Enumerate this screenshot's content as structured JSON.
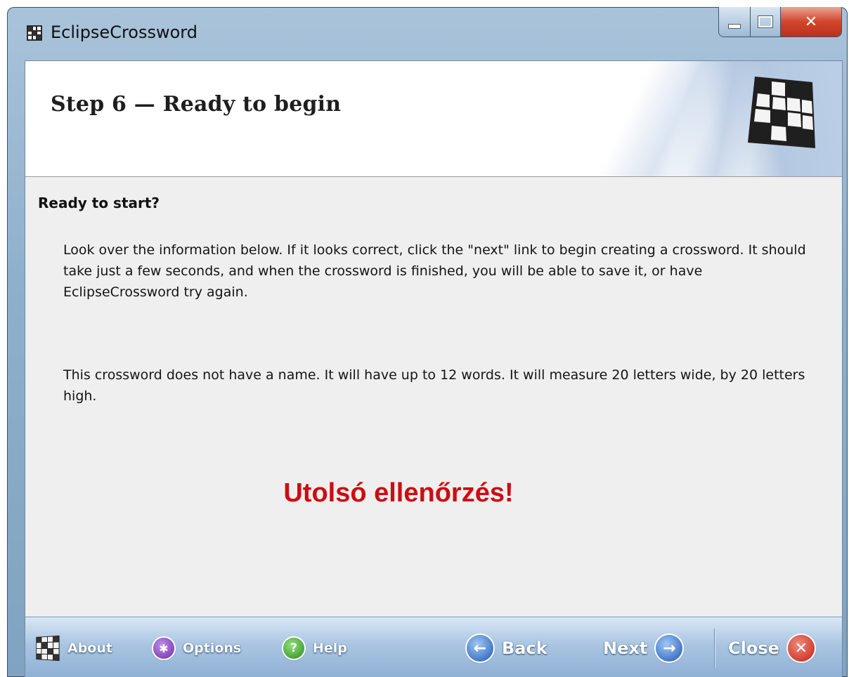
{
  "window": {
    "title": "EclipseCrossword",
    "icons": {
      "app": "crossword-grid-icon",
      "minimize": "minimize-icon",
      "maximize": "maximize-icon",
      "close": "close-x-icon"
    }
  },
  "header": {
    "title": "Step 6 — Ready to begin",
    "logo_icon": "crossword-grid-logo"
  },
  "content": {
    "section_heading": "Ready to start?",
    "paragraph1": "Look over the information below.  If it looks correct, click the \"next\" link to begin creating a crossword.  It should take just a few seconds, and when the crossword is finished, you will be able to save it, or have EclipseCrossword try again.",
    "paragraph2": "This crossword does not have a name.  It will have up to 12 words.  It will measure 20 letters wide, by 20 letters high.",
    "overlay_text": "Utolsó ellenőrzés!",
    "overlay_color": "#cc0d12"
  },
  "footer": {
    "about": {
      "label": "About",
      "icon": "crossword-grid-icon"
    },
    "options": {
      "label": "Options",
      "icon": "options-star-icon"
    },
    "help": {
      "label": "Help",
      "icon": "help-question-icon"
    },
    "back": {
      "label": "Back",
      "icon": "arrow-left-icon"
    },
    "next": {
      "label": "Next",
      "icon": "arrow-right-icon"
    },
    "close": {
      "label": "Close",
      "icon": "close-x-icon"
    }
  }
}
